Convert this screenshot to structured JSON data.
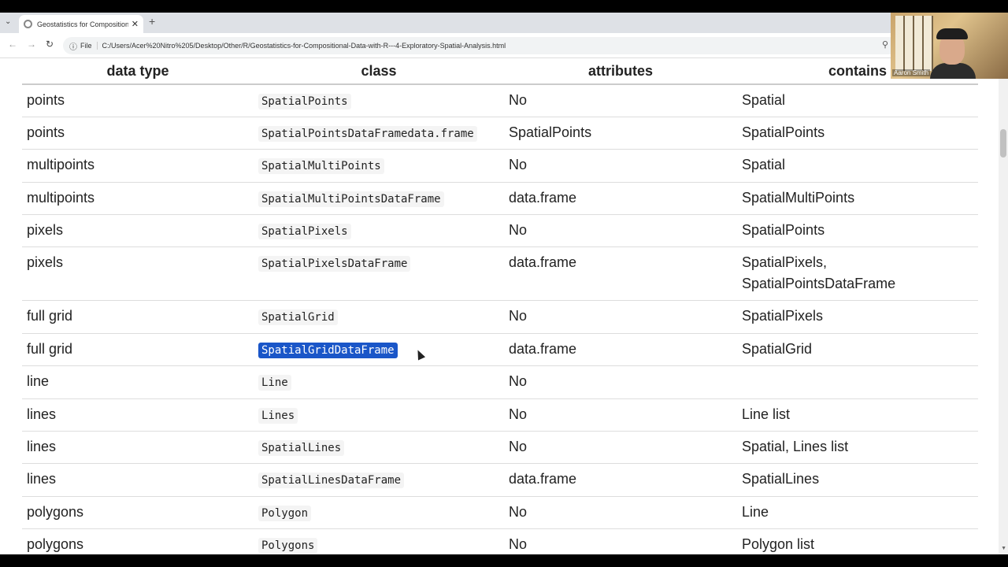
{
  "browser": {
    "tab_title": "Geostatistics for Compositional",
    "url_scheme": "File",
    "url": "C:/Users/Acer%20Nitro%205/Desktop/Other/R/Geostatistics-for-Compositional-Data-with-R---4-Exploratory-Spatial-Analysis.html"
  },
  "table": {
    "headers": [
      "data type",
      "class",
      "attributes",
      "contains"
    ],
    "rows": [
      {
        "type": "points",
        "cls": "SpatialPoints",
        "attr": "No",
        "contains": "Spatial"
      },
      {
        "type": "points",
        "cls": "SpatialPointsDataFramedata.frame",
        "attr": "SpatialPoints",
        "contains": "SpatialPoints"
      },
      {
        "type": "multipoints",
        "cls": "SpatialMultiPoints",
        "attr": "No",
        "contains": "Spatial"
      },
      {
        "type": "multipoints",
        "cls": "SpatialMultiPointsDataFrame",
        "attr": "data.frame",
        "contains": "SpatialMultiPoints"
      },
      {
        "type": "pixels",
        "cls": "SpatialPixels",
        "attr": "No",
        "contains": "SpatialPoints"
      },
      {
        "type": "pixels",
        "cls": "SpatialPixelsDataFrame",
        "attr": "data.frame",
        "contains": "SpatialPixels,",
        "contains2": "SpatialPointsDataFrame"
      },
      {
        "type": "full grid",
        "cls": "SpatialGrid",
        "attr": "No",
        "contains": "SpatialPixels"
      },
      {
        "type": "full grid",
        "cls": "SpatialGridDataFrame",
        "attr": "data.frame",
        "contains": "SpatialGrid"
      },
      {
        "type": "line",
        "cls": "Line",
        "attr": "No",
        "contains": ""
      },
      {
        "type": "lines",
        "cls": "Lines",
        "attr": "No",
        "contains": "Line list"
      },
      {
        "type": "lines",
        "cls": "SpatialLines",
        "attr": "No",
        "contains": "Spatial, Lines list"
      },
      {
        "type": "lines",
        "cls": "SpatialLinesDataFrame",
        "attr": "data.frame",
        "contains": "SpatialLines"
      },
      {
        "type": "polygons",
        "cls": "Polygon",
        "attr": "No",
        "contains": "Line"
      },
      {
        "type": "polygons",
        "cls": "Polygons",
        "attr": "No",
        "contains": "Polygon list"
      }
    ]
  },
  "webcam": {
    "name": "Aaron Smith"
  }
}
